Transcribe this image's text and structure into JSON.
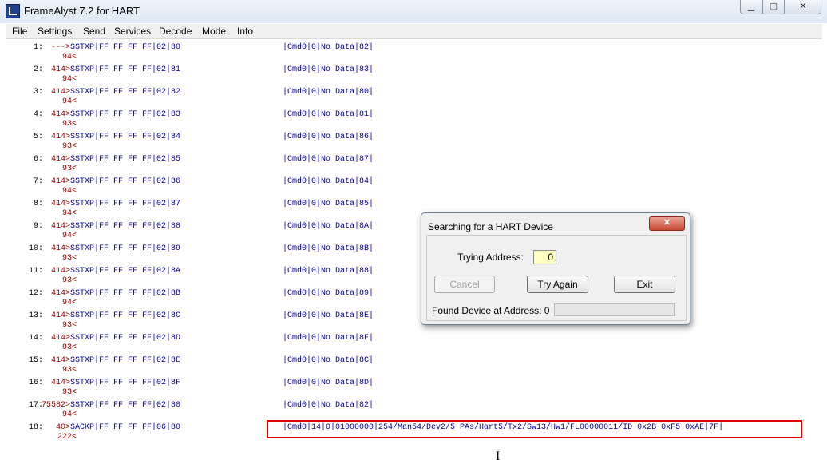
{
  "window": {
    "title": "FrameAlyst 7.2 for HART",
    "min_glyph": "▁",
    "max_glyph": "▢",
    "close_glyph": "✕"
  },
  "menu": [
    "File",
    "Settings",
    "Send",
    "Services",
    "Decode",
    "Mode",
    "Info"
  ],
  "log": [
    {
      "num": "1:",
      "count": "--->",
      "frame": "SSTXP|FF FF FF FF|02|80",
      "resp": "|Cmd0|0|No Data|82|",
      "tail": "94<"
    },
    {
      "num": "2:",
      "count": "414>",
      "frame": "SSTXP|FF FF FF FF|02|81",
      "resp": "|Cmd0|0|No Data|83|",
      "tail": "94<"
    },
    {
      "num": "3:",
      "count": "414>",
      "frame": "SSTXP|FF FF FF FF|02|82",
      "resp": "|Cmd0|0|No Data|80|",
      "tail": "94<"
    },
    {
      "num": "4:",
      "count": "414>",
      "frame": "SSTXP|FF FF FF FF|02|83",
      "resp": "|Cmd0|0|No Data|81|",
      "tail": "93<"
    },
    {
      "num": "5:",
      "count": "414>",
      "frame": "SSTXP|FF FF FF FF|02|84",
      "resp": "|Cmd0|0|No Data|86|",
      "tail": "93<"
    },
    {
      "num": "6:",
      "count": "414>",
      "frame": "SSTXP|FF FF FF FF|02|85",
      "resp": "|Cmd0|0|No Data|87|",
      "tail": "93<"
    },
    {
      "num": "7:",
      "count": "414>",
      "frame": "SSTXP|FF FF FF FF|02|86",
      "resp": "|Cmd0|0|No Data|84|",
      "tail": "94<"
    },
    {
      "num": "8:",
      "count": "414>",
      "frame": "SSTXP|FF FF FF FF|02|87",
      "resp": "|Cmd0|0|No Data|85|",
      "tail": "94<"
    },
    {
      "num": "9:",
      "count": "414>",
      "frame": "SSTXP|FF FF FF FF|02|88",
      "resp": "|Cmd0|0|No Data|8A|",
      "tail": "94<"
    },
    {
      "num": "10:",
      "count": "414>",
      "frame": "SSTXP|FF FF FF FF|02|89",
      "resp": "|Cmd0|0|No Data|8B|",
      "tail": "93<"
    },
    {
      "num": "11:",
      "count": "414>",
      "frame": "SSTXP|FF FF FF FF|02|8A",
      "resp": "|Cmd0|0|No Data|88|",
      "tail": "93<"
    },
    {
      "num": "12:",
      "count": "414>",
      "frame": "SSTXP|FF FF FF FF|02|8B",
      "resp": "|Cmd0|0|No Data|89|",
      "tail": "94<"
    },
    {
      "num": "13:",
      "count": "414>",
      "frame": "SSTXP|FF FF FF FF|02|8C",
      "resp": "|Cmd0|0|No Data|8E|",
      "tail": "93<"
    },
    {
      "num": "14:",
      "count": "414>",
      "frame": "SSTXP|FF FF FF FF|02|8D",
      "resp": "|Cmd0|0|No Data|8F|",
      "tail": "93<"
    },
    {
      "num": "15:",
      "count": "414>",
      "frame": "SSTXP|FF FF FF FF|02|8E",
      "resp": "|Cmd0|0|No Data|8C|",
      "tail": "93<"
    },
    {
      "num": "16:",
      "count": "414>",
      "frame": "SSTXP|FF FF FF FF|02|8F",
      "resp": "|Cmd0|0|No Data|8D|",
      "tail": "93<"
    },
    {
      "num": "17:",
      "count": "75582>",
      "frame": "SSTXP|FF FF FF FF|02|80",
      "resp": "|Cmd0|0|No Data|82|",
      "tail": "94<"
    },
    {
      "num": "18:",
      "count": "40>",
      "frame": "SACKP|FF FF FF FF|06|80",
      "resp": "|Cmd0|14|0|01000000|254/Man54/Dev2/5 PAs/Hart5/Tx2/Sw13/Hw1/FL00000011/ID 0x2B 0xF5 0xAE|7F|",
      "tail": "222<"
    }
  ],
  "dialog": {
    "title": "Searching for a HART Device",
    "close_glyph": "✕",
    "trying_label": "Trying Address:",
    "trying_value": "0",
    "cancel_label": "Cancel",
    "try_again_label": "Try Again",
    "exit_label": "Exit",
    "found_label": "Found Device at Address: 0",
    "progress": 0
  },
  "cursor_glyph": "I"
}
